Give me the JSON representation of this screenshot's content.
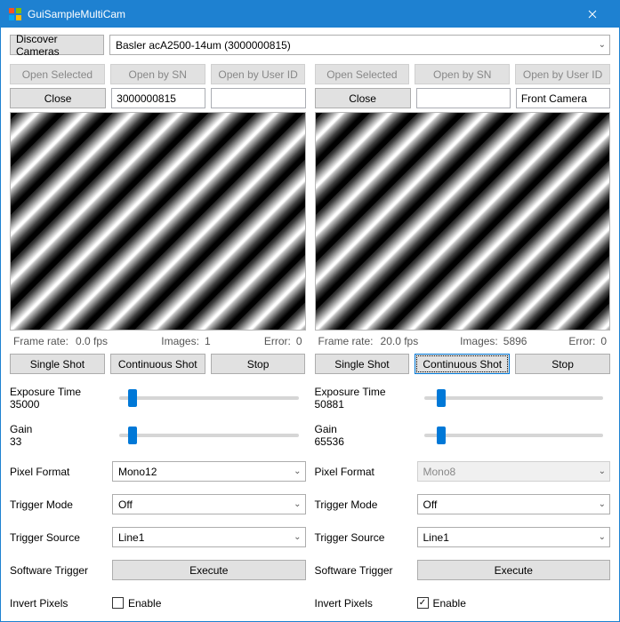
{
  "window": {
    "title": "GuiSampleMultiCam"
  },
  "top": {
    "discover_label": "Discover Cameras",
    "camera_selected": "Basler acA2500-14um (3000000815)"
  },
  "panels": [
    {
      "buttons": {
        "open_selected": "Open Selected",
        "open_by_sn": "Open by SN",
        "open_by_user_id": "Open by User ID",
        "close": "Close"
      },
      "inputs": {
        "sn": "3000000815",
        "user_id": ""
      },
      "stats": {
        "frame_rate_label": "Frame rate:",
        "frame_rate_value": "0.0 fps",
        "images_label": "Images:",
        "images_value": "1",
        "error_label": "Error:",
        "error_value": "0"
      },
      "capture": {
        "single_shot": "Single Shot",
        "continuous_shot": "Continuous Shot",
        "stop": "Stop",
        "continuous_active": false
      },
      "sliders": {
        "exposure_label": "Exposure Time",
        "exposure_value": "35000",
        "exposure_pos_pct": 5,
        "gain_label": "Gain",
        "gain_value": "33",
        "gain_pos_pct": 5
      },
      "params": {
        "pixel_format_label": "Pixel Format",
        "pixel_format_value": "Mono12",
        "pixel_format_disabled": false,
        "trigger_mode_label": "Trigger Mode",
        "trigger_mode_value": "Off",
        "trigger_source_label": "Trigger Source",
        "trigger_source_value": "Line1",
        "software_trigger_label": "Software Trigger",
        "software_trigger_button": "Execute",
        "invert_pixels_label": "Invert Pixels",
        "invert_pixels_checkbox_label": "Enable",
        "invert_pixels_checked": false
      }
    },
    {
      "buttons": {
        "open_selected": "Open Selected",
        "open_by_sn": "Open by SN",
        "open_by_user_id": "Open by User ID",
        "close": "Close"
      },
      "inputs": {
        "sn": "",
        "user_id": "Front Camera"
      },
      "stats": {
        "frame_rate_label": "Frame rate:",
        "frame_rate_value": "20.0 fps",
        "images_label": "Images:",
        "images_value": "5896",
        "error_label": "Error:",
        "error_value": "0"
      },
      "capture": {
        "single_shot": "Single Shot",
        "continuous_shot": "Continuous Shot",
        "stop": "Stop",
        "continuous_active": true
      },
      "sliders": {
        "exposure_label": "Exposure Time",
        "exposure_value": "50881",
        "exposure_pos_pct": 7,
        "gain_label": "Gain",
        "gain_value": "65536",
        "gain_pos_pct": 7
      },
      "params": {
        "pixel_format_label": "Pixel Format",
        "pixel_format_value": "Mono8",
        "pixel_format_disabled": true,
        "trigger_mode_label": "Trigger Mode",
        "trigger_mode_value": "Off",
        "trigger_source_label": "Trigger Source",
        "trigger_source_value": "Line1",
        "software_trigger_label": "Software Trigger",
        "software_trigger_button": "Execute",
        "invert_pixels_label": "Invert Pixels",
        "invert_pixels_checkbox_label": "Enable",
        "invert_pixels_checked": true
      }
    }
  ]
}
